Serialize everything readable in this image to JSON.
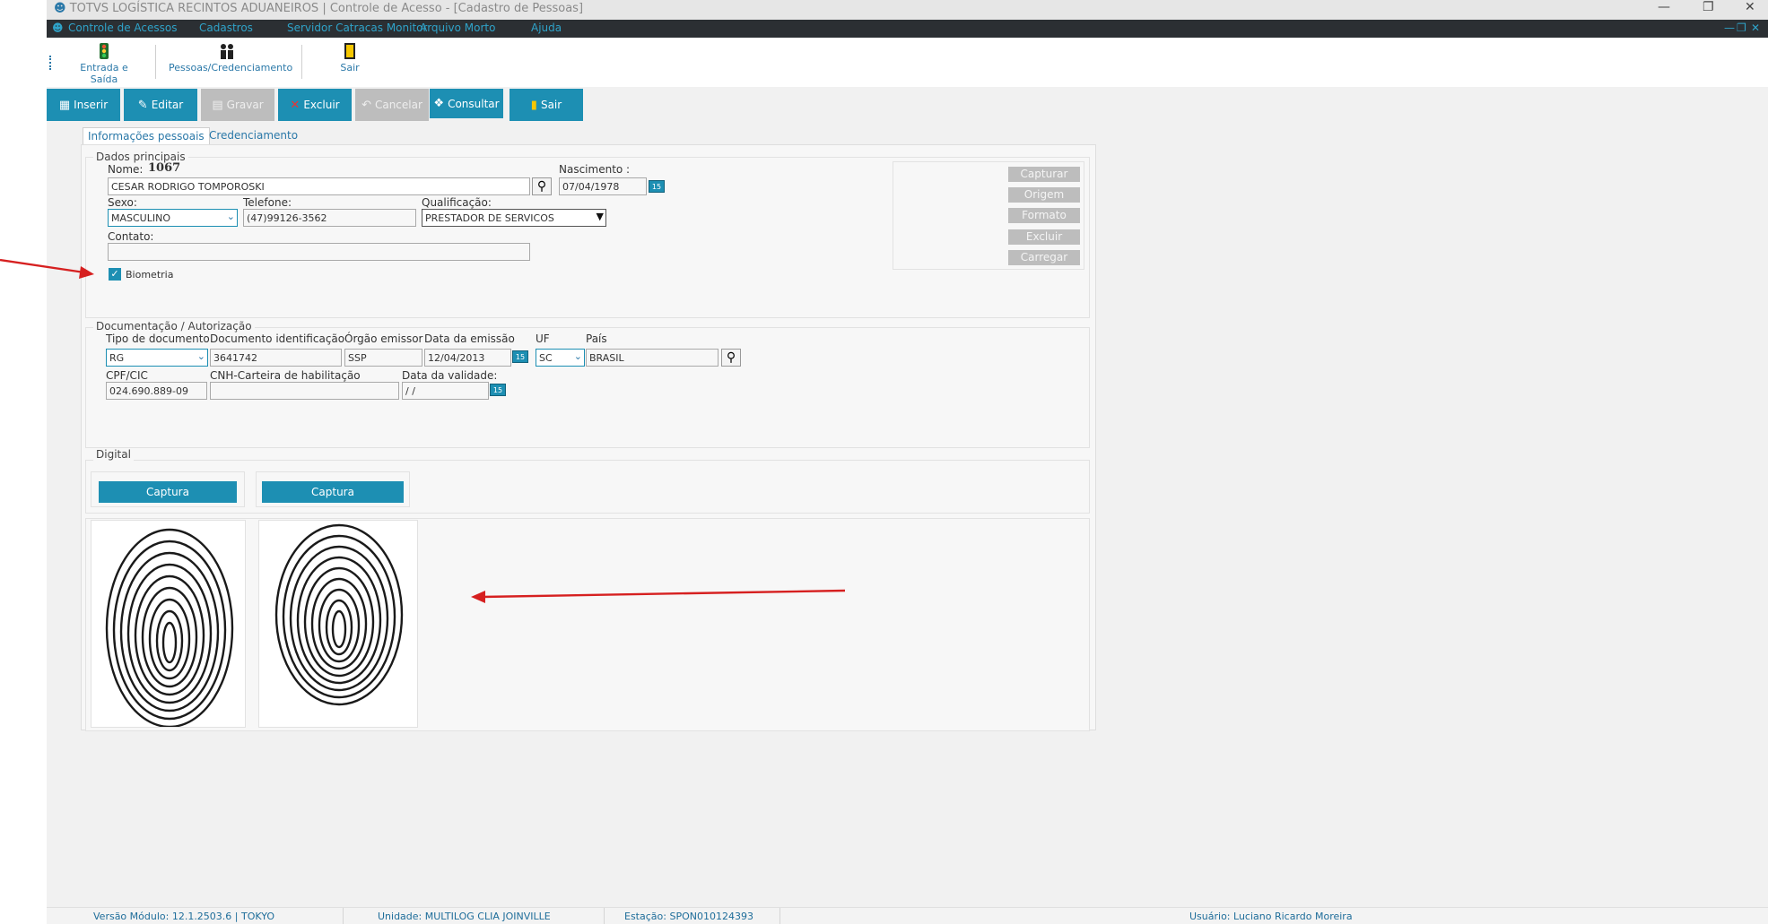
{
  "window": {
    "title": "TOTVS LOGÍSTICA RECINTOS ADUANEIROS | Controle de Acesso - [Cadastro de Pessoas]",
    "minimize": "—",
    "restore": "❐",
    "close": "✕"
  },
  "menu": {
    "items": [
      "Controle de Acessos",
      "Cadastros",
      "Servidor Catracas Monitor",
      "Arquivo Morto",
      "Ajuda"
    ],
    "inner_min": "—",
    "inner_restore": "❐",
    "inner_close": "✕"
  },
  "big_toolbar": {
    "entrada": "Entrada e Saída",
    "pessoas": "Pessoas/Credenciamento",
    "sair": "Sair"
  },
  "actions": {
    "inserir": "Inserir",
    "editar": "Editar",
    "gravar": "Gravar",
    "excluir": "Excluir",
    "cancelar": "Cancelar",
    "consultar": "Consultar",
    "sair": "Sair"
  },
  "tabs": [
    "Informações pessoais",
    "Credenciamento"
  ],
  "dados": {
    "group_label": "Dados principais",
    "nome_label": "Nome:",
    "nome_id": "1067",
    "nome_value": "CESAR RODRIGO TOMPOROSKI",
    "nascimento_label": "Nascimento :",
    "nascimento_value": "07/04/1978",
    "sexo_label": "Sexo:",
    "sexo_value": "MASCULINO",
    "telefone_label": "Telefone:",
    "telefone_value": "(47)99126-3562",
    "qualificacao_label": "Qualificação:",
    "qualificacao_value": "PRESTADOR DE SERVICOS",
    "contato_label": "Contato:",
    "contato_value": "",
    "biometria_label": "Biometria",
    "biometria_checked": true
  },
  "photo_buttons": [
    "Capturar",
    "Origem",
    "Formato",
    "Excluir",
    "Carregar"
  ],
  "doc": {
    "group_label": "Documentação / Autorização",
    "tipo_label": "Tipo de documento",
    "tipo_value": "RG",
    "docid_label": "Documento identificação",
    "docid_value": "3641742",
    "orgao_label": "Órgão emissor",
    "orgao_value": "SSP",
    "emissao_label": "Data da emissão",
    "emissao_value": "12/04/2013",
    "uf_label": "UF",
    "uf_value": "SC",
    "pais_label": "País",
    "pais_value": "BRASIL",
    "cpf_label": "CPF/CIC",
    "cpf_value": "024.690.889-09",
    "cnh_label": "CNH-Carteira de habilitação",
    "cnh_value": "",
    "validade_label": "Data da validade:",
    "validade_value": " /  /"
  },
  "digital": {
    "group_label": "Digital",
    "captura1": "Captura",
    "captura2": "Captura"
  },
  "status": {
    "versao": "Versão Módulo:  12.1.2503.6  |  TOKYO",
    "unidade": "Unidade: MULTILOG CLIA JOINVILLE",
    "estacao": "Estação: SPON010124393",
    "usuario": "Usuário: Luciano Ricardo Moreira"
  },
  "colors": {
    "accent": "#1d8fb3",
    "menubar": "#2b2f33",
    "annotation": "#d62020"
  },
  "icons": [
    "user-icon",
    "traffic-light-icon",
    "people-icon",
    "exit-door-icon",
    "calendar-icon",
    "magnifier-icon",
    "checkbox-icon",
    "fingerprint-icon",
    "arrow-annotation"
  ]
}
